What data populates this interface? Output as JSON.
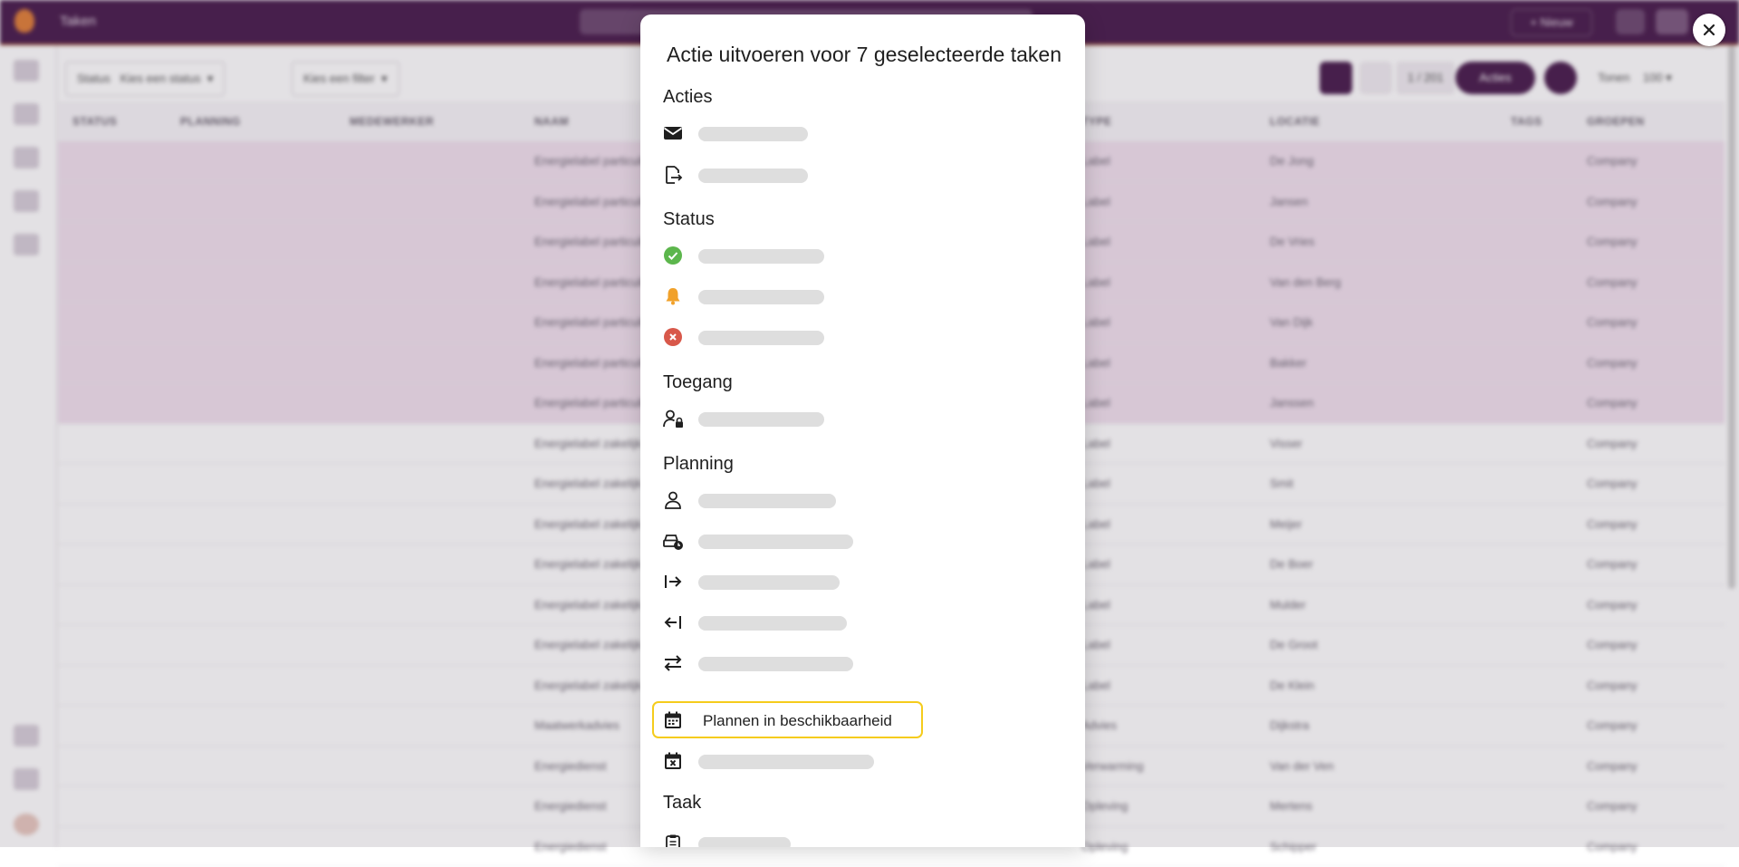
{
  "app": {
    "title": "Taken",
    "header_button": "+ Nieuw"
  },
  "toolbar": {
    "status_label": "Status",
    "status_value": "Kies een status",
    "filter_value": "Kies een filter",
    "count": "1 / 201",
    "action_button": "Acties",
    "show_label": "Tonen",
    "show_value": "100"
  },
  "table": {
    "columns": [
      "STATUS",
      "PLANNING",
      "MEDEWERKER",
      "NAAM",
      "TYPE",
      "LOCATIE",
      "TAGS",
      "GROEPEN"
    ],
    "rows": [
      {
        "name": "Energielabel particulier",
        "type": "Label",
        "location": "De Jong",
        "group": "Company"
      },
      {
        "name": "Energielabel particulier",
        "type": "Label",
        "location": "Jansen",
        "group": "Company"
      },
      {
        "name": "Energielabel particulier",
        "type": "Label",
        "location": "De Vries",
        "group": "Company"
      },
      {
        "name": "Energielabel particulier",
        "type": "Label",
        "location": "Van den Berg",
        "group": "Company"
      },
      {
        "name": "Energielabel particulier",
        "type": "Label",
        "location": "Van Dijk",
        "group": "Company"
      },
      {
        "name": "Energielabel particulier",
        "type": "Label",
        "location": "Bakker",
        "group": "Company"
      },
      {
        "name": "Energielabel particulier",
        "type": "Label",
        "location": "Janssen",
        "group": "Company"
      },
      {
        "name": "Energielabel zakelijk",
        "type": "Label",
        "location": "Visser",
        "group": "Company"
      },
      {
        "name": "Energielabel zakelijk",
        "type": "Label",
        "location": "Smit",
        "group": "Company"
      },
      {
        "name": "Energielabel zakelijk",
        "type": "Label",
        "location": "Meijer",
        "group": "Company"
      },
      {
        "name": "Energielabel zakelijk",
        "type": "Label",
        "location": "De Boer",
        "group": "Company"
      },
      {
        "name": "Energielabel zakelijk",
        "type": "Label",
        "location": "Mulder",
        "group": "Company"
      },
      {
        "name": "Energielabel zakelijk",
        "type": "Label",
        "location": "De Groot",
        "group": "Company"
      },
      {
        "name": "Energielabel zakelijk",
        "type": "Label",
        "location": "De Klein",
        "group": "Company"
      },
      {
        "name": "Maatwerkadvies",
        "type": "Advies",
        "location": "Dijkstra",
        "group": "Company"
      },
      {
        "name": "Energiedienst",
        "type": "Verwarming",
        "location": "Van der Ven",
        "group": "Company"
      },
      {
        "name": "Energiedienst",
        "type": "Opleving",
        "location": "Mertens",
        "group": "Company"
      },
      {
        "name": "Energiedienst",
        "type": "Opleving",
        "location": "Schipper",
        "group": "Company"
      }
    ]
  },
  "modal": {
    "title": "Actie uitvoeren voor 7 geselecteerde taken",
    "sections": {
      "acties": "Acties",
      "status": "Status",
      "toegang": "Toegang",
      "planning": "Planning",
      "taak": "Taak"
    },
    "highlighted_item": "Plannen in beschikbaarheid"
  },
  "colors": {
    "brand": "#4a1e4e",
    "highlight_border": "#f5cc1c",
    "status_done": "#5cb64c",
    "status_alert": "#f1a12a",
    "status_cancel": "#d8584a"
  }
}
